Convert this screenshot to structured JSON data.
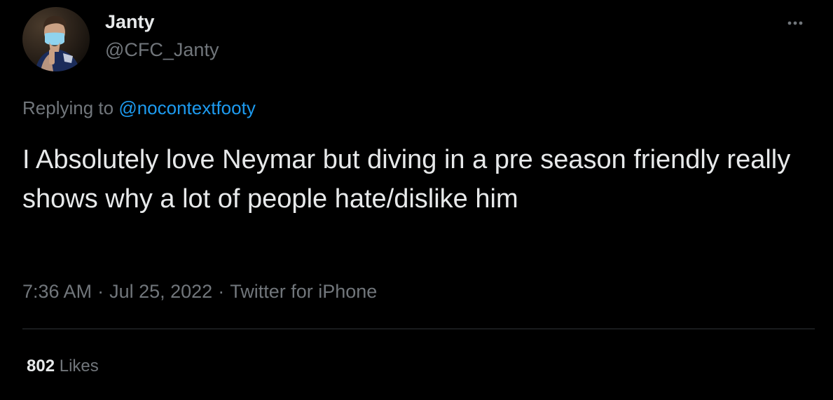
{
  "colors": {
    "background": "#000000",
    "primary_text": "#e7e9ea",
    "secondary_text": "#71767b",
    "link": "#1d9bf0",
    "divider": "#2f3336"
  },
  "author": {
    "display_name": "Janty",
    "handle": "@CFC_Janty",
    "avatar_icon": "profile-photo-avatar"
  },
  "more_icon": "more-horizontal-icon",
  "reply": {
    "prefix": "Replying to",
    "mention": "@nocontextfooty"
  },
  "tweet": {
    "text": "I Absolutely love Neymar but diving in a pre season friendly really shows why a lot of people hate/dislike him"
  },
  "meta": {
    "time": "7:36 AM",
    "separator": "·",
    "date": "Jul 25, 2022",
    "source": "Twitter for iPhone"
  },
  "stats": {
    "likes_count": "802",
    "likes_label": "Likes"
  }
}
